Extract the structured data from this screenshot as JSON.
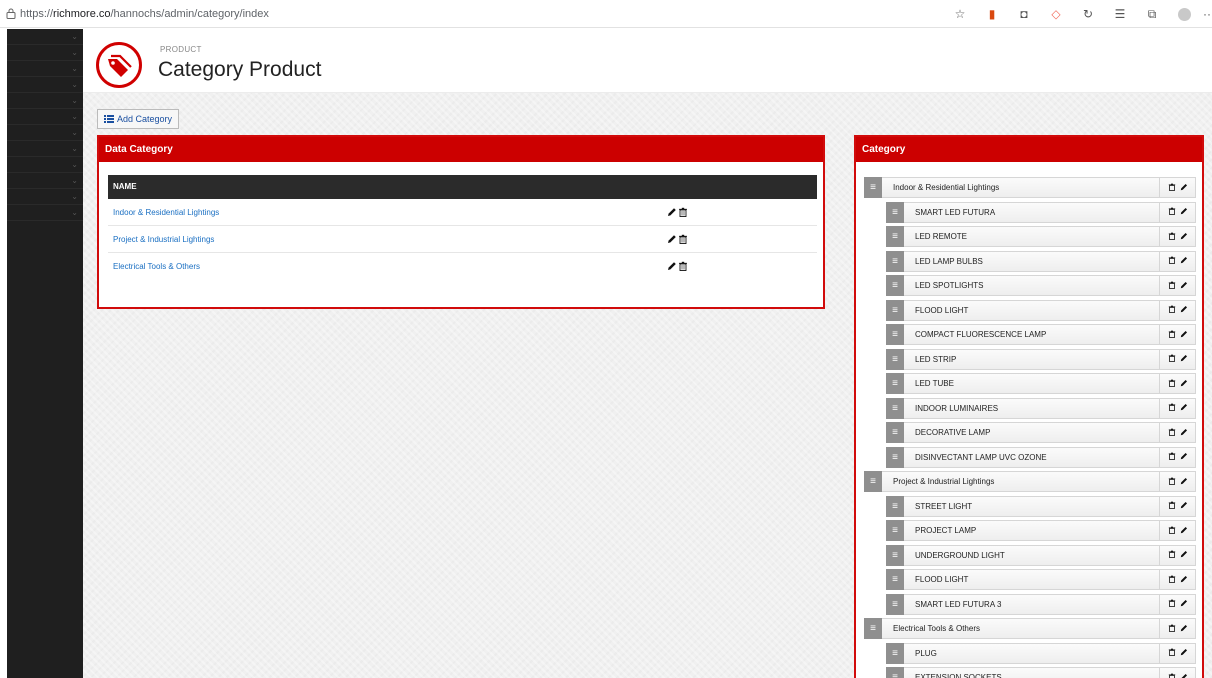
{
  "browser": {
    "url_prefix": "https://",
    "url_domain": "richmore.co",
    "url_path": "/hannochs/admin/category/index",
    "extra": "··"
  },
  "colors": {
    "brand_red": "#cc0000",
    "link_blue": "#1a6fc2",
    "sidebar": "#1f1f1f"
  },
  "header": {
    "subtitle": "PRODUCT",
    "title": "Category Product",
    "icon": "tag-icon"
  },
  "toolbar": {
    "add_label": "Add Category",
    "add_icon": "list-icon"
  },
  "data_panel": {
    "title": "Data Category",
    "column": "NAME",
    "rows": [
      "Indoor & Residential Lightings",
      "Project & Industrial Lightings",
      "Electrical Tools & Others"
    ]
  },
  "category_panel": {
    "title": "Category",
    "handle_glyph": "≡",
    "tree": [
      {
        "label": "Indoor & Residential Lightings",
        "level": 0
      },
      {
        "label": "SMART LED FUTURA",
        "level": 1
      },
      {
        "label": "LED REMOTE",
        "level": 1
      },
      {
        "label": "LED LAMP BULBS",
        "level": 1
      },
      {
        "label": "LED SPOTLIGHTS",
        "level": 1
      },
      {
        "label": "FLOOD LIGHT",
        "level": 1
      },
      {
        "label": "COMPACT FLUORESCENCE LAMP",
        "level": 1
      },
      {
        "label": "LED STRIP",
        "level": 1
      },
      {
        "label": "LED TUBE",
        "level": 1
      },
      {
        "label": "INDOOR LUMINAIRES",
        "level": 1
      },
      {
        "label": "DECORATIVE LAMP",
        "level": 1
      },
      {
        "label": "DISINVECTANT LAMP UVC OZONE",
        "level": 1
      },
      {
        "label": "Project & Industrial Lightings",
        "level": 0
      },
      {
        "label": "STREET LIGHT",
        "level": 1
      },
      {
        "label": "PROJECT LAMP",
        "level": 1
      },
      {
        "label": "UNDERGROUND LIGHT",
        "level": 1
      },
      {
        "label": "FLOOD LIGHT",
        "level": 1
      },
      {
        "label": "SMART LED FUTURA 3",
        "level": 1
      },
      {
        "label": "Electrical Tools & Others",
        "level": 0
      },
      {
        "label": "PLUG",
        "level": 1
      },
      {
        "label": "EXTENSION SOCKETS",
        "level": 1
      }
    ]
  }
}
